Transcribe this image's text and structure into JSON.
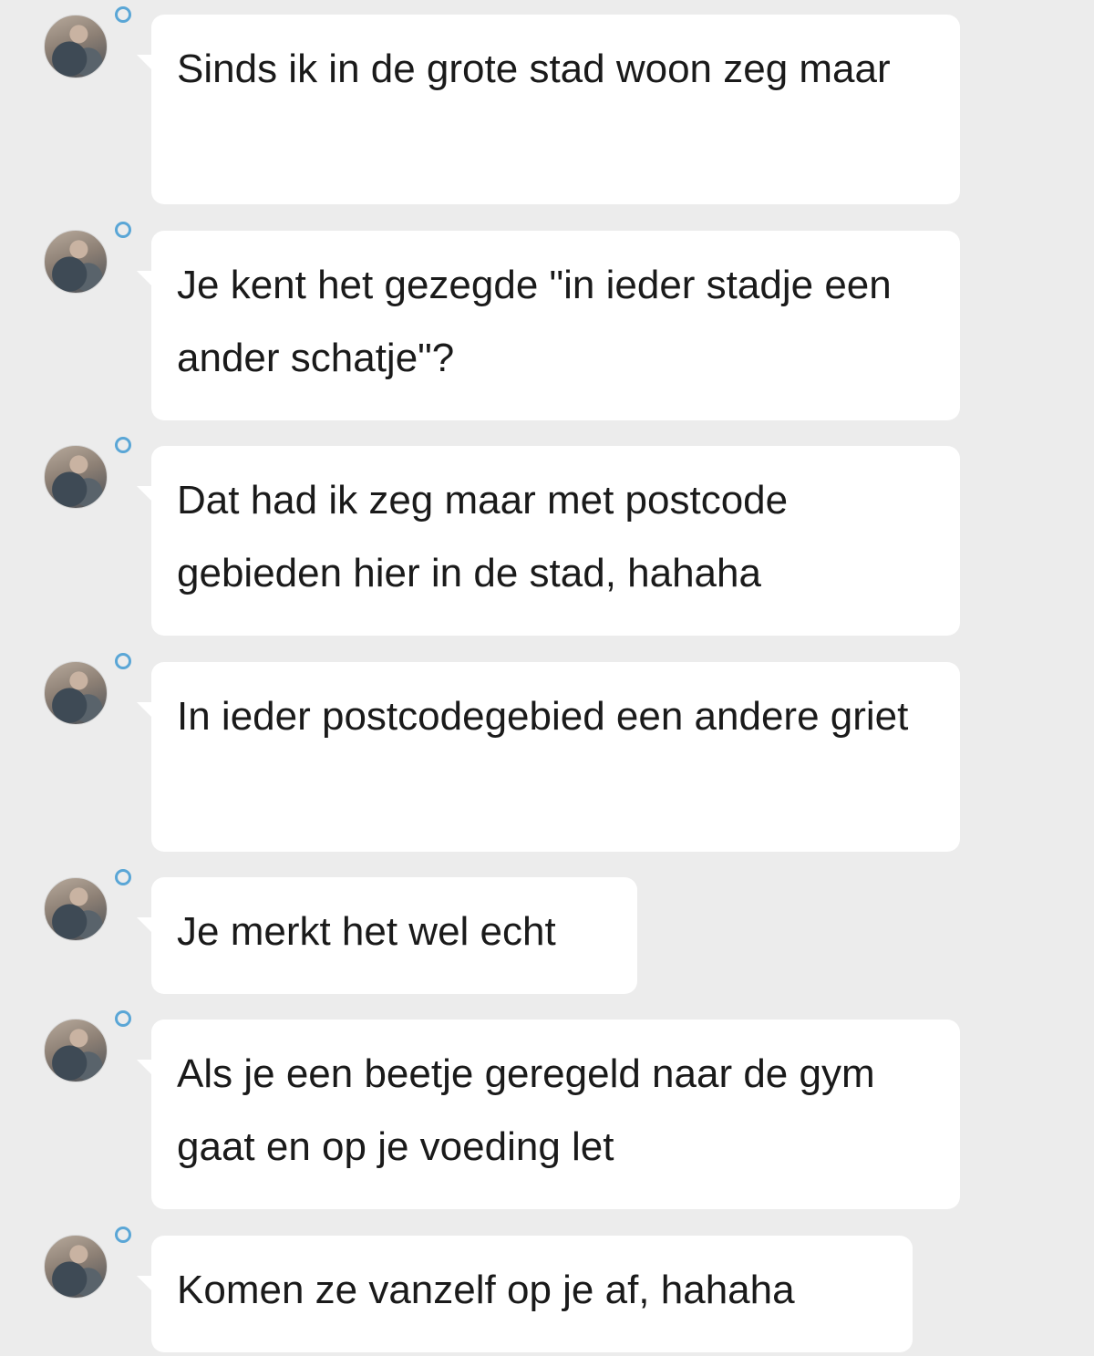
{
  "messages": [
    {
      "text": "Sinds ik in de grote stad woon zeg maar"
    },
    {
      "text": "Je kent het gezegde \"in ieder stadje een ander schatje\"?"
    },
    {
      "text": "Dat had ik zeg maar met postcode gebieden hier in de stad, hahaha"
    },
    {
      "text": "In ieder postcodegebied een andere griet"
    },
    {
      "text": "Je merkt het wel echt"
    },
    {
      "text": "Als je een beetje geregeld naar de gym gaat en op je voeding let"
    },
    {
      "text": "Komen ze vanzelf op je af, hahaha"
    }
  ],
  "colors": {
    "background": "#ececec",
    "bubble": "#ffffff",
    "status_ring": "#5aa6d6",
    "text": "#1a1a1a"
  },
  "icons": {
    "avatar": "profile-photo",
    "status": "status-ring-icon"
  }
}
